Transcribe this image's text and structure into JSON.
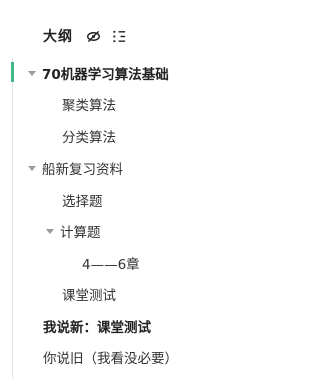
{
  "outline": {
    "title": "大纲",
    "icons": {
      "hide": "eye-off-icon",
      "list": "list-icon"
    },
    "accent_color": "#42b983",
    "items": [
      {
        "label": "70机器学习算法基础",
        "bold": true,
        "expanded": true,
        "active": true
      },
      {
        "label": "聚类算法"
      },
      {
        "label": "分类算法"
      },
      {
        "label": "船新复习资料",
        "expanded": true
      },
      {
        "label": "选择题"
      },
      {
        "label": "计算题",
        "expanded": true
      },
      {
        "label": "4——6章"
      },
      {
        "label": "课堂测试"
      },
      {
        "label": "我说新：课堂测试",
        "bold": true
      },
      {
        "label": "你说旧（我看没必要）"
      }
    ]
  }
}
